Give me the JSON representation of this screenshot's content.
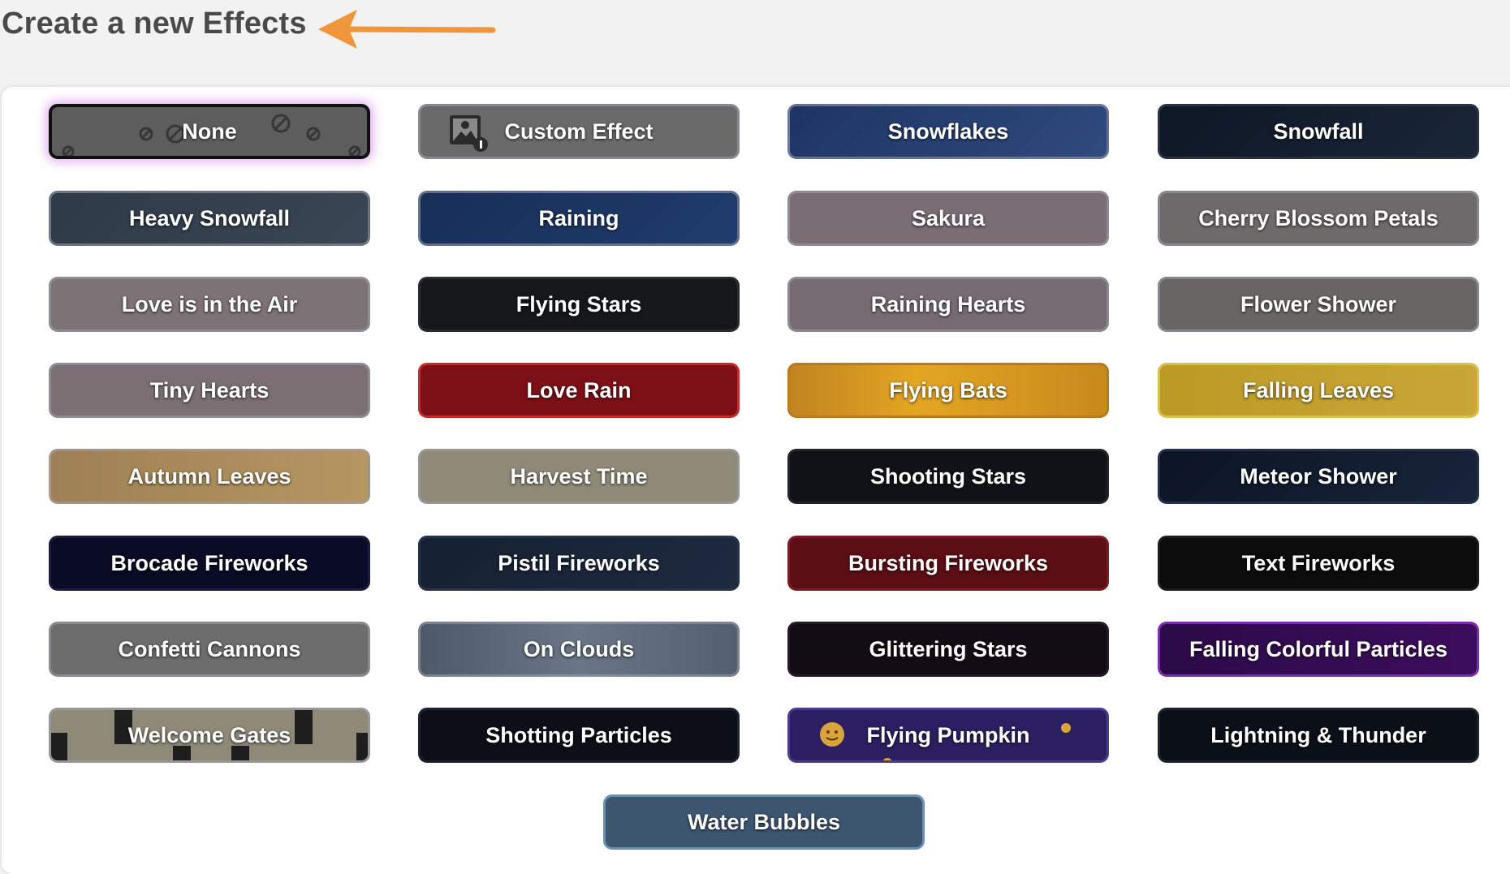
{
  "header": {
    "title": "Create a new Effects"
  },
  "colors": {
    "arrow": "#f0963a",
    "selected_glow": "#cd78e6",
    "panel": "#ffffff"
  },
  "effects": [
    {
      "label": "None",
      "selected": true
    },
    {
      "label": "Custom Effect",
      "icon": "image-upload-icon"
    },
    {
      "label": "Snowflakes"
    },
    {
      "label": "Snowfall"
    },
    {
      "label": "Heavy Snowfall"
    },
    {
      "label": "Raining"
    },
    {
      "label": "Sakura"
    },
    {
      "label": "Cherry Blossom Petals"
    },
    {
      "label": "Love is in the Air"
    },
    {
      "label": "Flying Stars"
    },
    {
      "label": "Raining Hearts"
    },
    {
      "label": "Flower Shower"
    },
    {
      "label": "Tiny Hearts"
    },
    {
      "label": "Love Rain"
    },
    {
      "label": "Flying Bats"
    },
    {
      "label": "Falling Leaves"
    },
    {
      "label": "Autumn Leaves"
    },
    {
      "label": "Harvest Time"
    },
    {
      "label": "Shooting Stars"
    },
    {
      "label": "Meteor Shower"
    },
    {
      "label": "Brocade Fireworks"
    },
    {
      "label": "Pistil Fireworks"
    },
    {
      "label": "Bursting Fireworks"
    },
    {
      "label": "Text Fireworks"
    },
    {
      "label": "Confetti Cannons"
    },
    {
      "label": "On Clouds"
    },
    {
      "label": "Glittering Stars"
    },
    {
      "label": "Falling Colorful Particles"
    },
    {
      "label": "Welcome Gates"
    },
    {
      "label": "Shotting Particles"
    },
    {
      "label": "Flying Pumpkin"
    },
    {
      "label": "Lightning & Thunder"
    },
    {
      "label": "Water Bubbles"
    }
  ]
}
